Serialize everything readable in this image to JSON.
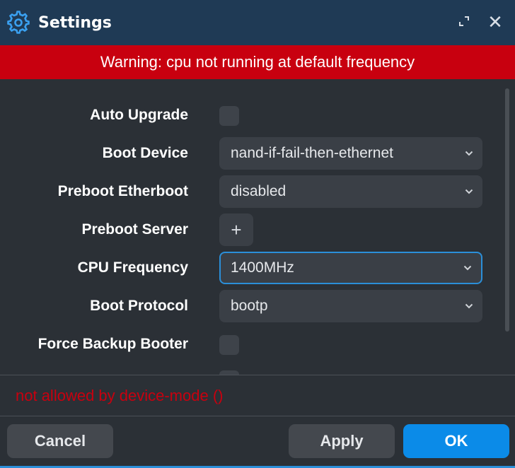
{
  "window": {
    "title": "Settings",
    "icons": {
      "app": "gear-icon",
      "maximize": "maximize-icon",
      "close": "close-icon"
    },
    "close_glyph": "✕"
  },
  "warning": {
    "text": "Warning: cpu not running at default frequency"
  },
  "settings": {
    "auto_upgrade": {
      "label": "Auto Upgrade",
      "checked": false
    },
    "boot_device": {
      "label": "Boot Device",
      "value": "nand-if-fail-then-ethernet"
    },
    "preboot_etherboot": {
      "label": "Preboot Etherboot",
      "value": "disabled"
    },
    "preboot_server": {
      "label": "Preboot Server",
      "add_glyph": "+"
    },
    "cpu_frequency": {
      "label": "CPU Frequency",
      "value": "1400MHz"
    },
    "boot_protocol": {
      "label": "Boot Protocol",
      "value": "bootp"
    },
    "force_backup_booter": {
      "label": "Force Backup Booter",
      "checked": false
    }
  },
  "error": {
    "text": "not allowed by device-mode ()"
  },
  "footer": {
    "cancel_label": "Cancel",
    "apply_label": "Apply",
    "ok_label": "OK"
  },
  "colors": {
    "titlebar": "#1f3a55",
    "warning_bg": "#c8000f",
    "error_text": "#c8000f",
    "accent": "#0b8be8",
    "background": "#2b3036"
  }
}
